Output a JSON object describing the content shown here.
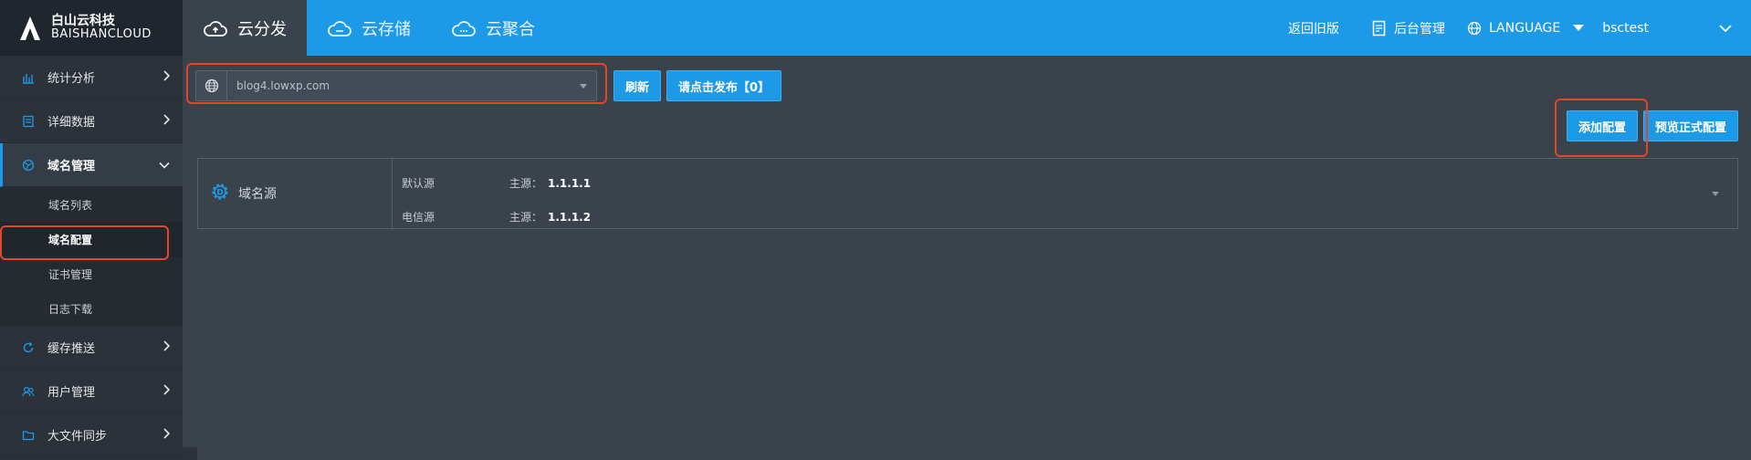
{
  "brand": {
    "name_cn": "白山云科技",
    "name_en": "BAISHANCLOUD"
  },
  "top_tabs": [
    {
      "label": "云分发",
      "icon": "cloud-upload-icon",
      "active": true
    },
    {
      "label": "云存储",
      "icon": "cloud-storage-icon",
      "active": false
    },
    {
      "label": "云聚合",
      "icon": "cloud-aggregate-icon",
      "active": false
    }
  ],
  "top_right": {
    "old_version": "返回旧版",
    "admin": "后台管理",
    "language": "LANGUAGE",
    "user": "bsctest"
  },
  "sidebar": {
    "items": [
      {
        "label": "统计分析",
        "icon": "bar-chart-icon"
      },
      {
        "label": "详细数据",
        "icon": "document-icon"
      },
      {
        "label": "域名管理",
        "icon": "globe-icon",
        "open": true
      },
      {
        "label": "缓存推送",
        "icon": "refresh-icon"
      },
      {
        "label": "用户管理",
        "icon": "users-icon"
      },
      {
        "label": "大文件同步",
        "icon": "folder-icon"
      }
    ],
    "sub_items": [
      {
        "label": "域名列表"
      },
      {
        "label": "域名配置",
        "active": true
      },
      {
        "label": "证书管理"
      },
      {
        "label": "日志下载"
      }
    ]
  },
  "toolbar": {
    "domain": "blog4.lowxp.com",
    "refresh_label": "刷新",
    "publish_label": "请点击发布【0】"
  },
  "actions": {
    "add_config": "添加配置",
    "preview_config": "预览正式配置"
  },
  "config": {
    "section_title": "域名源",
    "rows": [
      {
        "name": "默认源",
        "key": "主源：",
        "value": "1.1.1.1"
      },
      {
        "name": "电信源",
        "key": "主源：",
        "value": "1.1.1.2"
      }
    ]
  },
  "colors": {
    "accent": "#1d9ae7",
    "annotation": "#e5452c",
    "bg": "#3a424b",
    "sidebar": "#2b323a"
  }
}
